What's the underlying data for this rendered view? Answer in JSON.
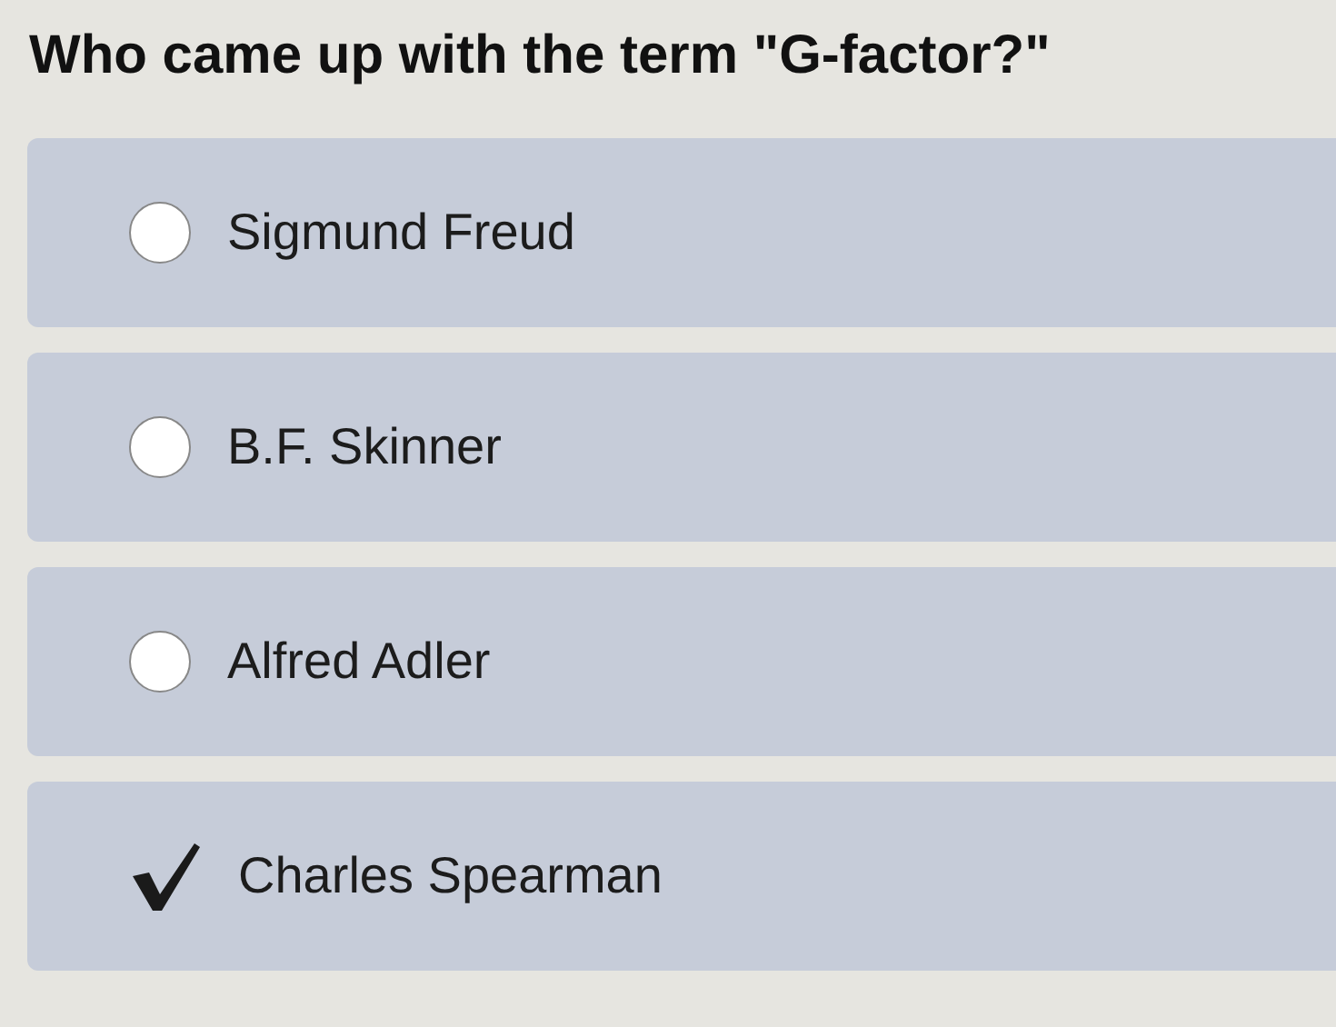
{
  "question": "Who came up with the term \"G-factor?\"",
  "options": [
    {
      "label": "Sigmund Freud",
      "selected": false
    },
    {
      "label": "B.F. Skinner",
      "selected": false
    },
    {
      "label": "Alfred Adler",
      "selected": false
    },
    {
      "label": "Charles Spearman",
      "selected": true
    }
  ]
}
